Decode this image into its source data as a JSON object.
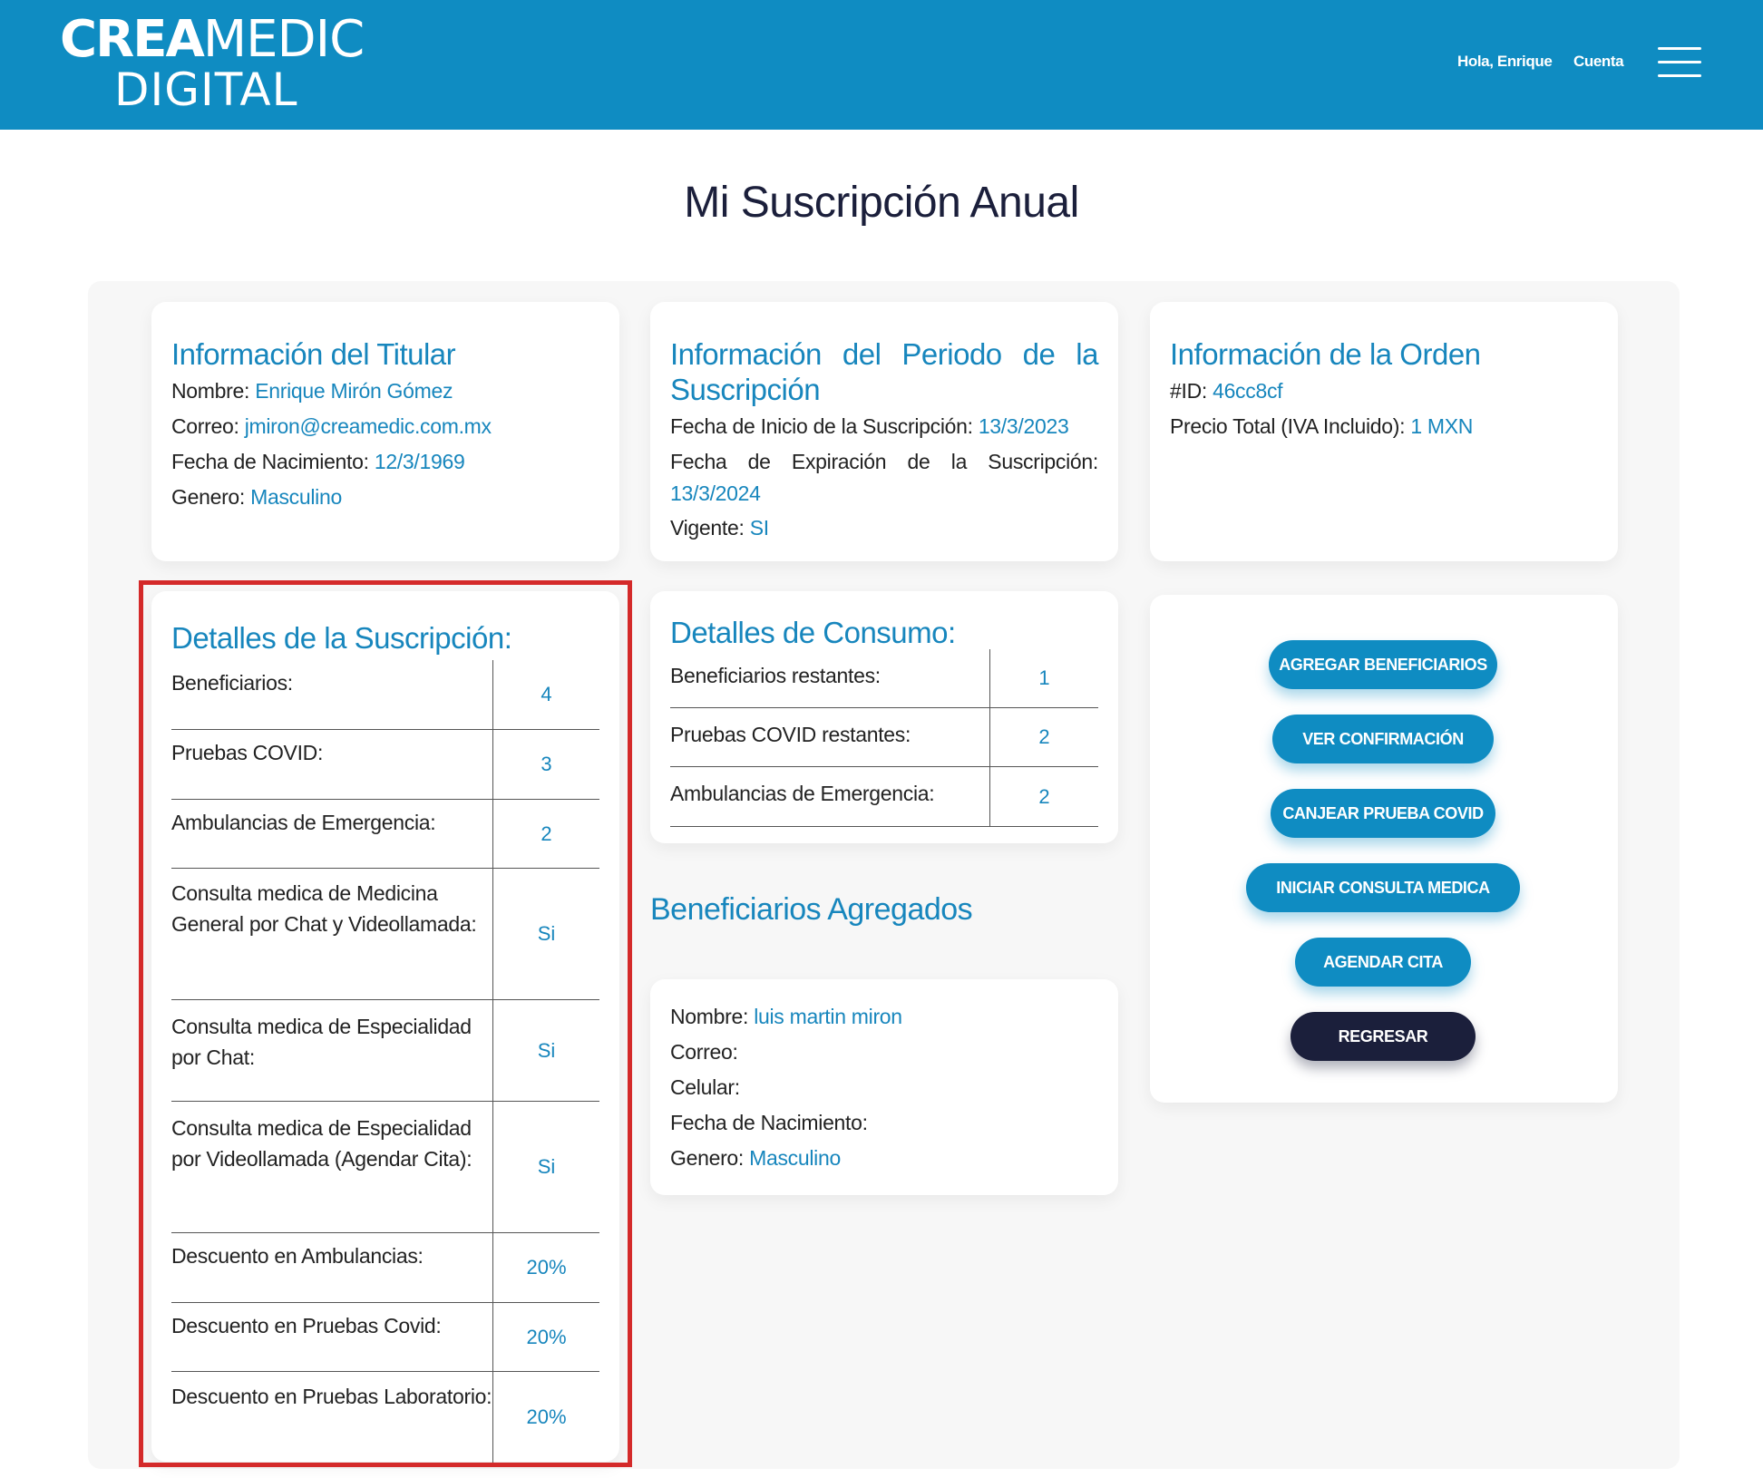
{
  "header": {
    "logo_crea": "CREA",
    "logo_medic": "MEDIC",
    "logo_digital": "DIGITAL",
    "greeting": "Hola, Enrique",
    "account": "Cuenta"
  },
  "page_title": "Mi Suscripción Anual",
  "titular": {
    "title": "Información del Titular",
    "fields": [
      {
        "label": "Nombre:",
        "value": "Enrique Mirón Gómez"
      },
      {
        "label": "Correo:",
        "value": "jmiron@creamedic.com.mx"
      },
      {
        "label": "Fecha de Nacimiento:",
        "value": "12/3/1969"
      },
      {
        "label": "Genero:",
        "value": "Masculino"
      }
    ]
  },
  "periodo": {
    "title": "Información del Periodo de la Suscripción",
    "inicio_label": "Fecha de Inicio de la Suscripción:",
    "inicio_value": "13/3/2023",
    "expiracion_label": "Fecha de Expiración de la Suscripción:",
    "expiracion_value": "13/3/2024",
    "vigente_label": "Vigente:",
    "vigente_value": "SI"
  },
  "orden": {
    "title": "Información de la Orden",
    "id_label": "#ID:",
    "id_value": "46cc8cf",
    "precio_label": "Precio Total (IVA Incluido):",
    "precio_value": "1 MXN"
  },
  "detalles": {
    "title": "Detalles de la Suscripción:",
    "rows": [
      {
        "label": "Beneficiarios:",
        "value": "4"
      },
      {
        "label": "Pruebas COVID:",
        "value": "3"
      },
      {
        "label": "Ambulancias de Emergencia:",
        "value": "2"
      },
      {
        "label": "Consulta medica de Medicina General por Chat y Videollamada:",
        "value": "Si"
      },
      {
        "label": "Consulta medica de Especialidad por Chat:",
        "value": "Si"
      },
      {
        "label": "Consulta medica de Especialidad por Videollamada (Agendar Cita):",
        "value": "Si"
      },
      {
        "label": "Descuento en Ambulancias:",
        "value": "20%"
      },
      {
        "label": "Descuento en Pruebas Covid:",
        "value": "20%"
      },
      {
        "label": "Descuento en Pruebas Laboratorio:",
        "value": "20%"
      }
    ]
  },
  "consumo": {
    "title": "Detalles de Consumo:",
    "rows": [
      {
        "label": "Beneficiarios restantes:",
        "value": "1"
      },
      {
        "label": "Pruebas COVID restantes:",
        "value": "2"
      },
      {
        "label": "Ambulancias de Emergencia:",
        "value": "2"
      }
    ]
  },
  "beneficiarios": {
    "title": "Beneficiarios Agregados",
    "items": [
      {
        "nombre_label": "Nombre:",
        "nombre_value": "luis martin miron",
        "correo_label": "Correo:",
        "celular_label": "Celular:",
        "nacimiento_label": "Fecha de Nacimiento:",
        "genero_label": "Genero:",
        "genero_value": "Masculino"
      }
    ]
  },
  "actions": {
    "agregar": "AGREGAR BENEFICIARIOS",
    "confirmacion": "VER CONFIRMACIÓN",
    "canjear": "CANJEAR PRUEBA COVID",
    "iniciar": "INICIAR CONSULTA MEDICA",
    "agendar": "AGENDAR CITA",
    "regresar": "REGRESAR"
  },
  "colors": {
    "brand": "#0f8cc2",
    "accent_text": "#1786bd",
    "dark_button": "#1b1f3b",
    "highlight": "#d42a2a"
  }
}
